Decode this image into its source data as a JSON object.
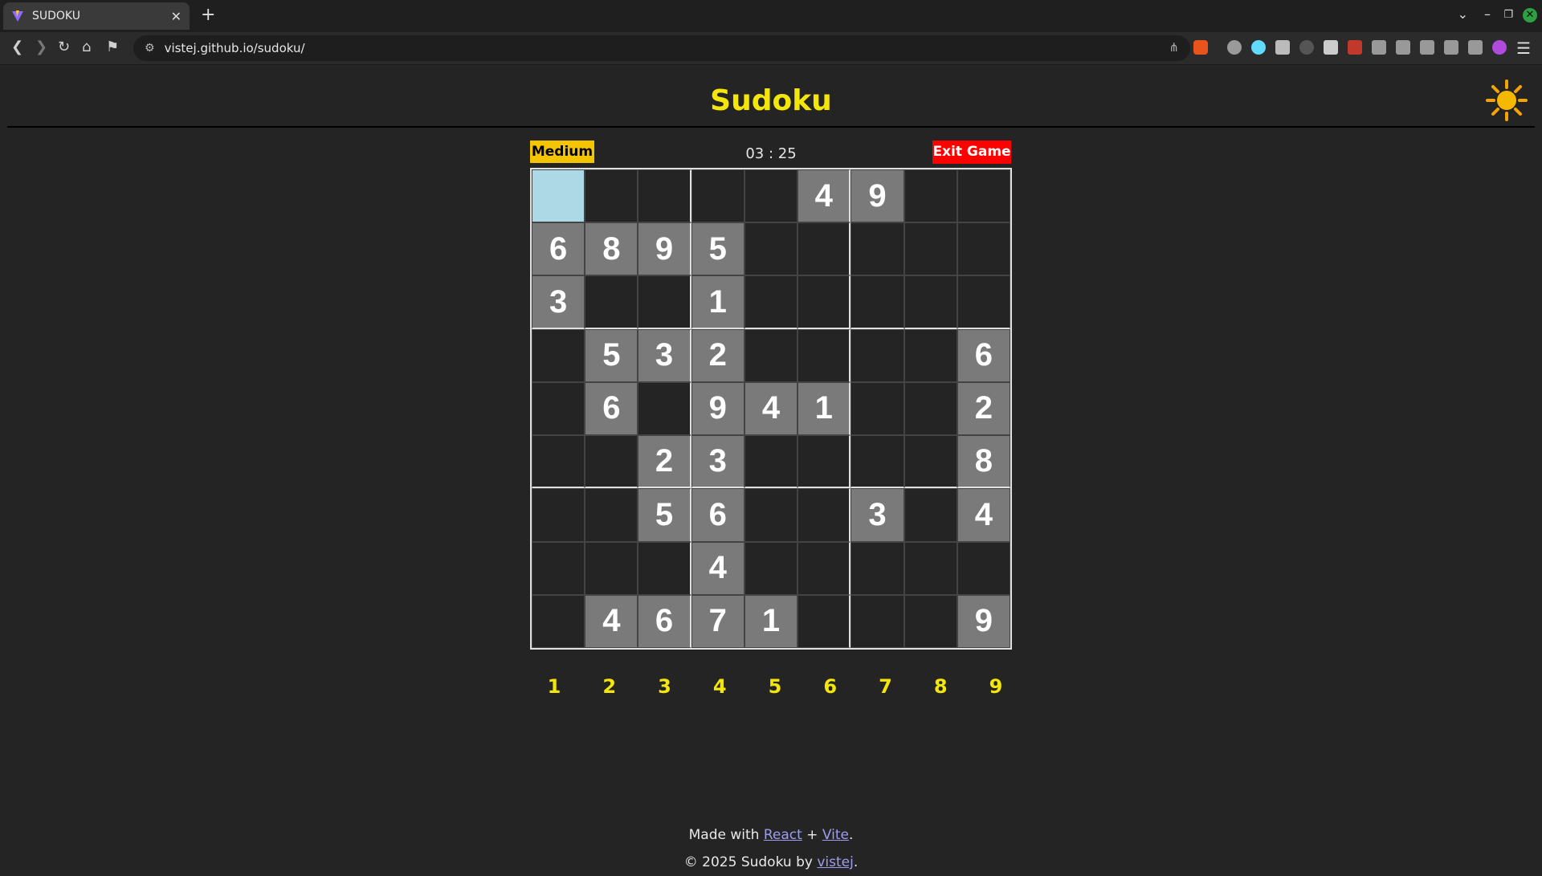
{
  "browser": {
    "tab_title": "SUDOKU",
    "new_tab": "+",
    "url": "vistej.github.io/sudoku/"
  },
  "header": {
    "title": "Sudoku",
    "theme_icon": "sun-icon"
  },
  "game": {
    "difficulty": "Medium",
    "timer": "03 : 25",
    "exit_label": "Exit Game",
    "grid": [
      [
        "",
        "",
        "",
        "",
        "",
        "4",
        "9",
        "",
        ""
      ],
      [
        "6",
        "8",
        "9",
        "5",
        "",
        "",
        "",
        "",
        ""
      ],
      [
        "3",
        "",
        "",
        "1",
        "",
        "",
        "",
        "",
        ""
      ],
      [
        "",
        "5",
        "3",
        "2",
        "",
        "",
        "",
        "",
        "6"
      ],
      [
        "",
        "6",
        "",
        "9",
        "4",
        "1",
        "",
        "",
        "2"
      ],
      [
        "",
        "",
        "2",
        "3",
        "",
        "",
        "",
        "",
        "8"
      ],
      [
        "",
        "",
        "5",
        "6",
        "",
        "",
        "3",
        "",
        "4"
      ],
      [
        "",
        "",
        "",
        "4",
        "",
        "",
        "",
        "",
        ""
      ],
      [
        "",
        "4",
        "6",
        "7",
        "1",
        "",
        "",
        "",
        "9"
      ]
    ],
    "selected_cell": [
      0,
      0
    ],
    "numbers": [
      "1",
      "2",
      "3",
      "4",
      "5",
      "6",
      "7",
      "8",
      "9"
    ]
  },
  "footer": {
    "line1_prefix": "Made with ",
    "react": "React",
    "plus": " + ",
    "vite": "Vite",
    "period": ".",
    "line2_prefix": "© 2025 Sudoku by ",
    "author": "vistej",
    "period2": "."
  },
  "colors": {
    "accent": "#f5e60a",
    "difficulty_bg": "#f5c400",
    "exit_bg": "#ff0000",
    "given_cell": "#7a7a7a",
    "selected_cell": "#add8e6"
  }
}
